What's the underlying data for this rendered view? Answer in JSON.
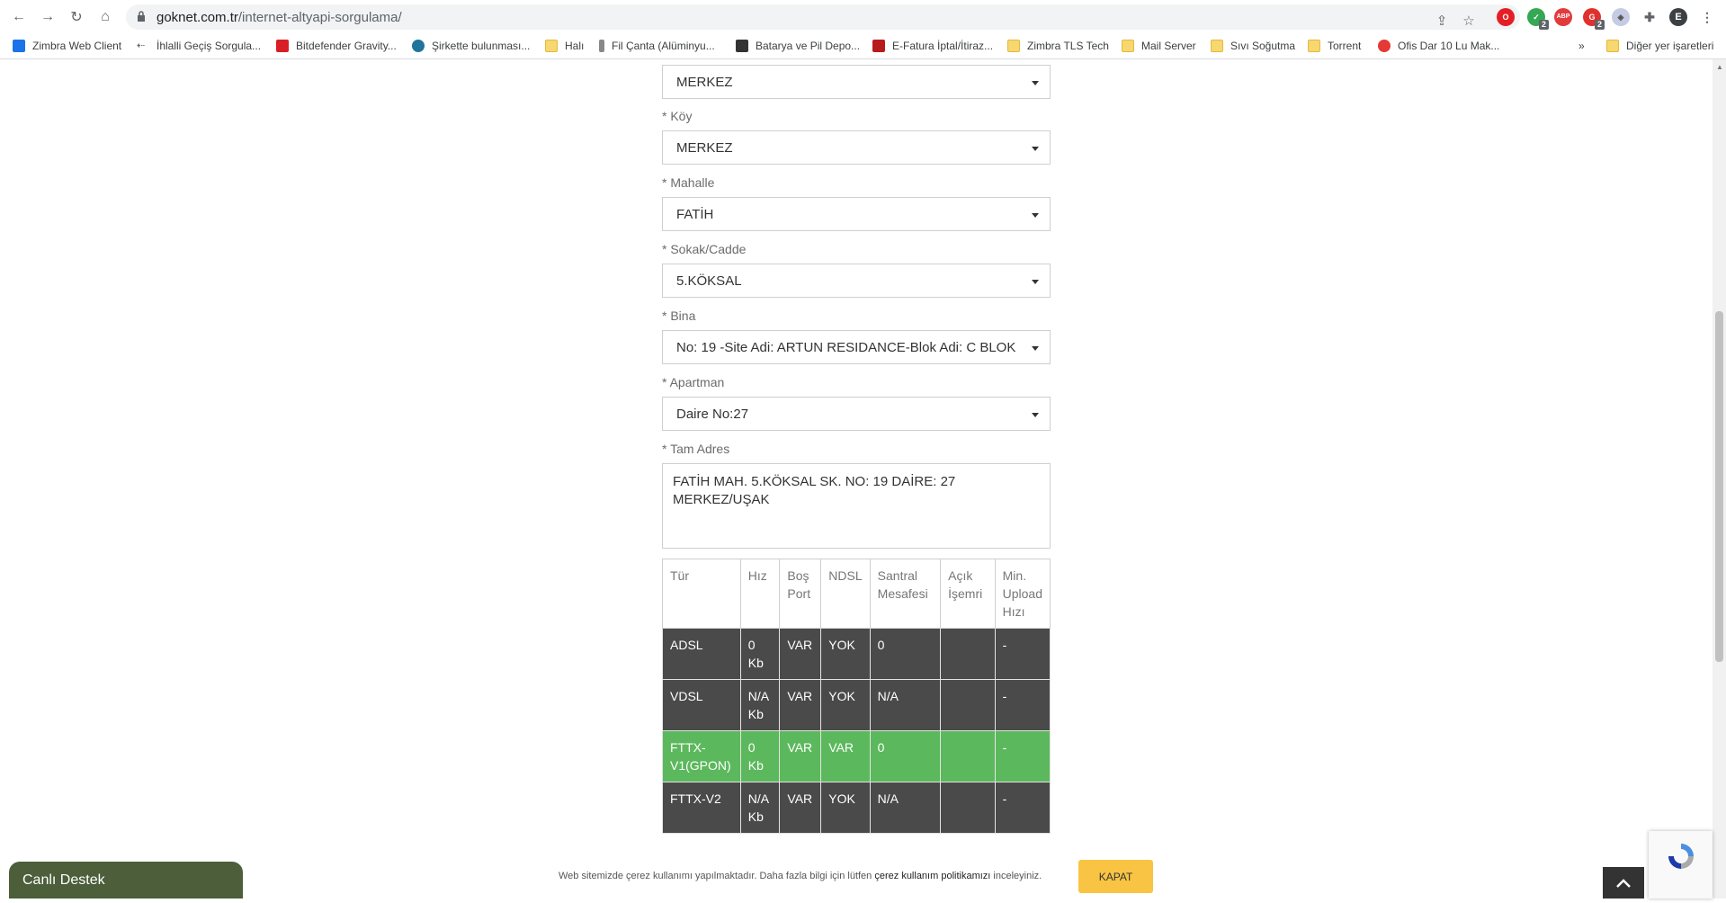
{
  "browser": {
    "url_domain": "goknet.com.tr",
    "url_path": "/internet-altyapi-sorgulama/",
    "profile_initial": "E",
    "ext_badges": [
      "2",
      "2"
    ],
    "bookmarks": [
      {
        "label": "Zimbra Web Client",
        "icon": "zimbra-icon"
      },
      {
        "label": "İhlalli Geçiş Sorgula...",
        "icon": "arrow-icon"
      },
      {
        "label": "Bitdefender Gravity...",
        "icon": "bitdefender-icon"
      },
      {
        "label": "Şirkette bulunması...",
        "icon": "wordpress-icon"
      },
      {
        "label": "Halı",
        "icon": "folder-icon"
      },
      {
        "label": "Fil Çanta (Alüminyu...",
        "icon": "page-icon"
      },
      {
        "label": "Batarya ve Pil Depo...",
        "icon": "page-icon"
      },
      {
        "label": "E-Fatura İptal/İtiraz...",
        "icon": "page-icon"
      },
      {
        "label": "Zimbra TLS Tech",
        "icon": "folder-icon"
      },
      {
        "label": "Mail Server",
        "icon": "folder-icon"
      },
      {
        "label": "Sıvı Soğutma",
        "icon": "folder-icon"
      },
      {
        "label": "Torrent",
        "icon": "folder-icon"
      },
      {
        "label": "Ofis Dar 10 Lu  Mak...",
        "icon": "page-icon"
      }
    ],
    "overflow": "»",
    "other_bookmarks": "Diğer yer işaretleri"
  },
  "form": {
    "fields": [
      {
        "label": "",
        "value": "MERKEZ"
      },
      {
        "label": "* Köy",
        "value": "MERKEZ"
      },
      {
        "label": "* Mahalle",
        "value": "FATİH"
      },
      {
        "label": "* Sokak/Cadde",
        "value": "5.KÖKSAL"
      },
      {
        "label": "* Bina",
        "value": "No: 19 -Site Adi: ARTUN RESIDANCE-Blok Adi: C BLOK"
      },
      {
        "label": "* Apartman",
        "value": "Daire No:27"
      }
    ],
    "address_label": "* Tam Adres",
    "address_value": "FATİH MAH. 5.KÖKSAL SK. NO: 19 DAİRE: 27 MERKEZ/UŞAK"
  },
  "table": {
    "headers": [
      "Tür",
      "Hız",
      "Boş Port",
      "NDSL",
      "Santral Mesafesi",
      "Açık İşemri",
      "Min. Upload Hızı"
    ],
    "rows": [
      [
        "ADSL",
        "0 Kb",
        "VAR",
        "YOK",
        "0",
        "",
        "-"
      ],
      [
        "VDSL",
        "N/A Kb",
        "VAR",
        "YOK",
        "N/A",
        "",
        "-"
      ],
      [
        "FTTX-V1(GPON)",
        "0 Kb",
        "VAR",
        "VAR",
        "0",
        "",
        "-"
      ],
      [
        "FTTX-V2",
        "N/A Kb",
        "VAR",
        "YOK",
        "N/A",
        "",
        "-"
      ]
    ],
    "highlight_row": 2,
    "highlight_color": "#5cb85c",
    "row_color": "#4a4a4a"
  },
  "footer": {
    "live_support": "Canlı Destek",
    "cookie_text_pre": "Web sitemizde çerez kullanımı yapılmaktadır. Daha fazla bilgi için lütfen ",
    "cookie_link": "çerez kullanım politikamızı",
    "cookie_text_post": " inceleyiniz.",
    "kapat": "KAPAT"
  }
}
